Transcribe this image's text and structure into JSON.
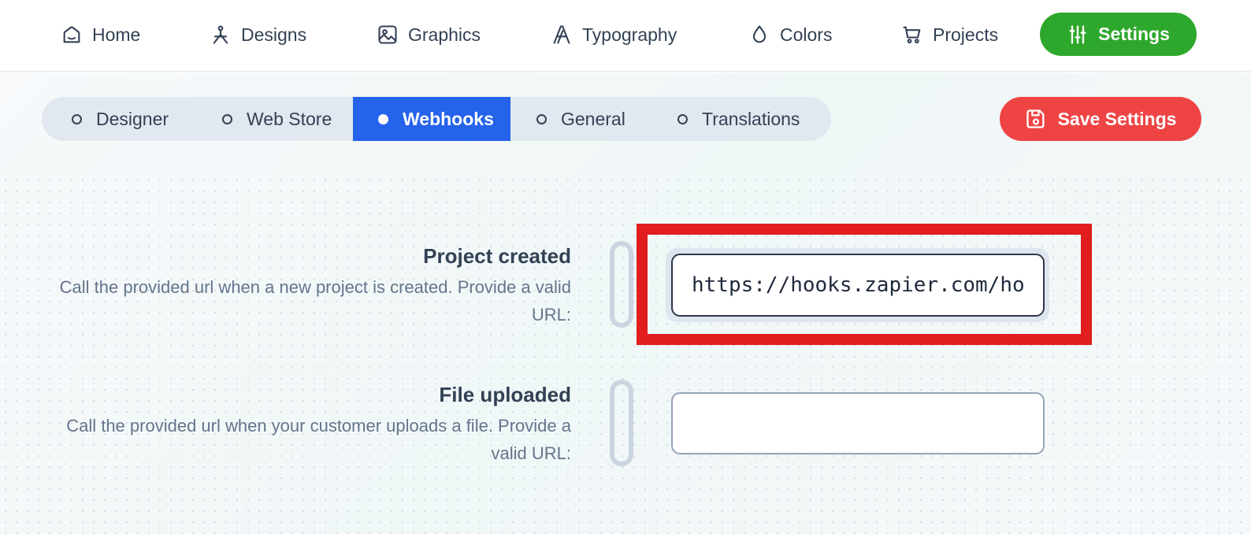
{
  "nav": {
    "items": [
      {
        "label": "Home",
        "icon": "home-icon"
      },
      {
        "label": "Designs",
        "icon": "pen-tool-icon"
      },
      {
        "label": "Graphics",
        "icon": "image-icon"
      },
      {
        "label": "Typography",
        "icon": "typography-icon"
      },
      {
        "label": "Colors",
        "icon": "droplet-icon"
      },
      {
        "label": "Projects",
        "icon": "cart-icon"
      }
    ],
    "settings_label": "Settings",
    "settings_color": "#2ea82c"
  },
  "tabs": {
    "items": [
      {
        "label": "Designer",
        "active": false
      },
      {
        "label": "Web Store",
        "active": false
      },
      {
        "label": "Webhooks",
        "active": true
      },
      {
        "label": "General",
        "active": false
      },
      {
        "label": "Translations",
        "active": false
      }
    ],
    "active_color": "#2563eb"
  },
  "save_button": {
    "label": "Save Settings",
    "color": "#ef4444"
  },
  "webhooks": [
    {
      "title": "Project created",
      "description": "Call the provided url when a new project is created. Provide a valid URL:",
      "value": "https://hooks.zapier.com/hooks/catch/",
      "placeholder": ""
    },
    {
      "title": "File uploaded",
      "description": "Call the provided url when your customer uploads a file. Provide a valid URL:",
      "value": "",
      "placeholder": ""
    }
  ]
}
